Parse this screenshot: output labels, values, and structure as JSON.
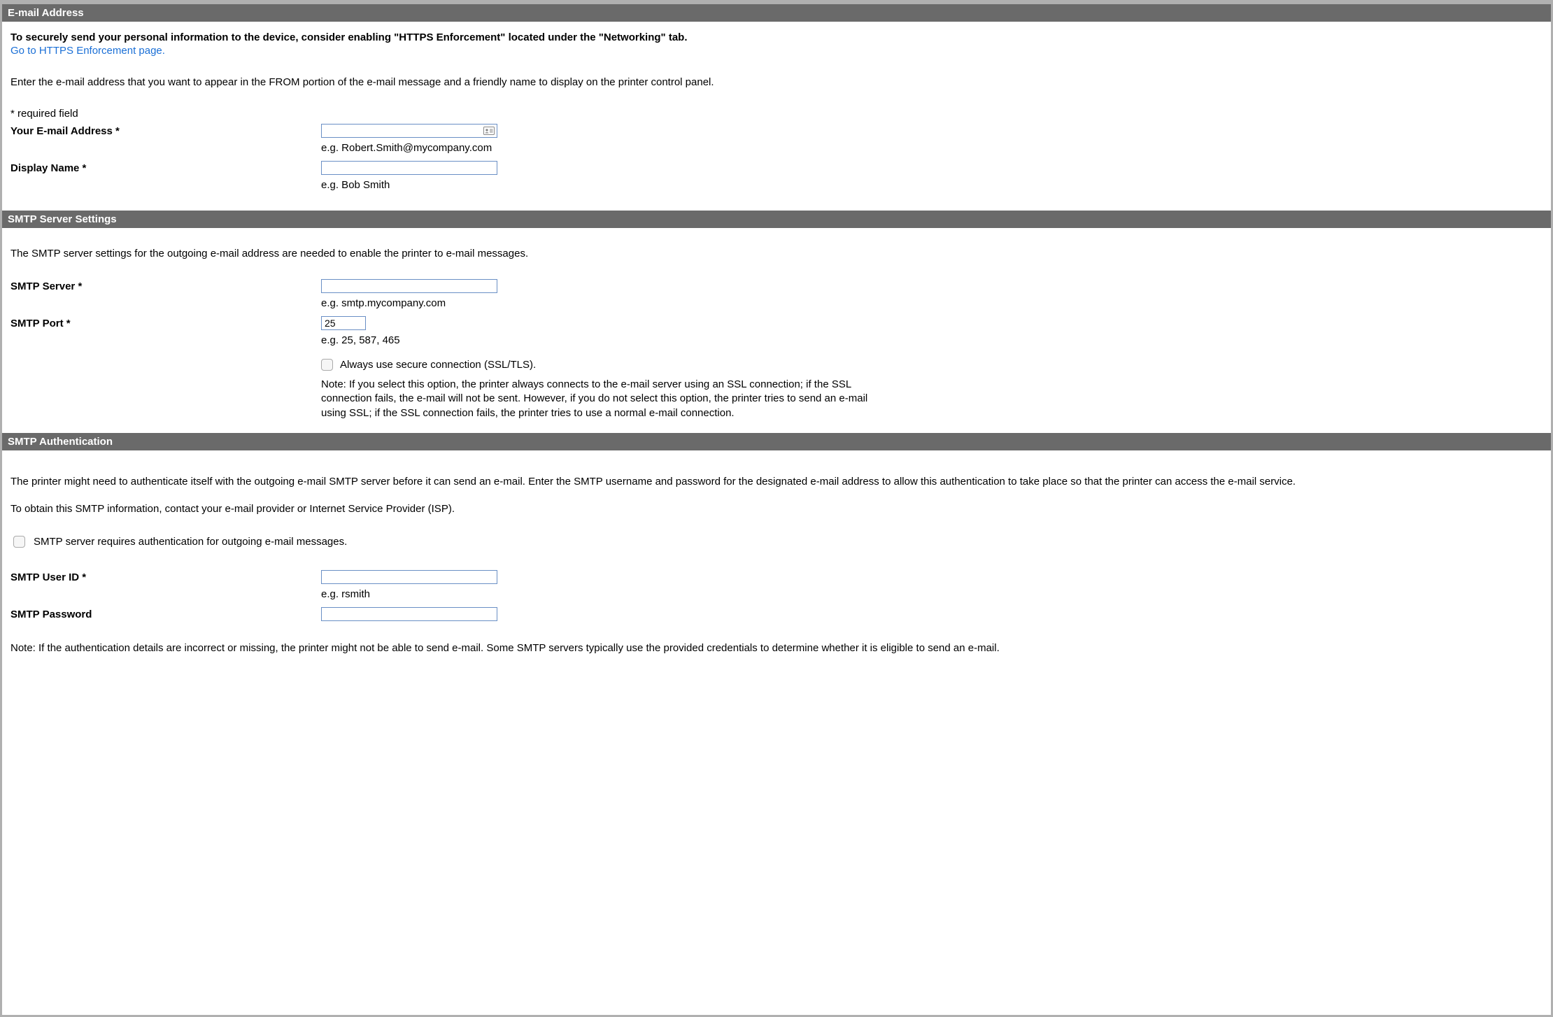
{
  "email_section": {
    "header": "E-mail Address",
    "security_notice": "To securely send your personal information to the device, consider enabling \"HTTPS Enforcement\" located under the \"Networking\" tab.",
    "https_link": "Go to HTTPS Enforcement page.",
    "description": "Enter the e-mail address that you want to appear in the FROM portion of the e-mail message and a friendly name to display on the printer control panel.",
    "required_note": "* required field",
    "email_label": "Your E-mail Address *",
    "email_value": "",
    "email_hint": "e.g. Robert.Smith@mycompany.com",
    "display_name_label": "Display Name *",
    "display_name_value": "",
    "display_name_hint": "e.g. Bob Smith"
  },
  "smtp_section": {
    "header": "SMTP Server Settings",
    "description": "The SMTP server settings for the outgoing e-mail address are needed to enable the printer to e-mail messages.",
    "server_label": "SMTP Server *",
    "server_value": "",
    "server_hint": "e.g. smtp.mycompany.com",
    "port_label": "SMTP Port *",
    "port_value": "25",
    "port_hint": "e.g. 25, 587, 465",
    "ssl_label": "Always use secure connection (SSL/TLS).",
    "ssl_note": "Note: If you select this option, the printer always connects to the e-mail server using an SSL connection; if the SSL connection fails, the e-mail will not be sent. However, if you do not select this option, the printer tries to send an e-mail using SSL; if the SSL connection fails, the printer tries to use a normal e-mail connection."
  },
  "auth_section": {
    "header": "SMTP Authentication",
    "description1": "The printer might need to authenticate itself with the outgoing e-mail SMTP server before it can send an e-mail. Enter the SMTP username and password for the designated e-mail address to allow this authentication to take place so that the printer can access the e-mail service.",
    "description2": "To obtain this SMTP information, contact your e-mail provider or Internet Service Provider (ISP).",
    "requires_auth_label": "SMTP server requires authentication for outgoing e-mail messages.",
    "user_label": "SMTP User ID *",
    "user_value": "",
    "user_hint": "e.g. rsmith",
    "password_label": "SMTP Password",
    "password_value": "",
    "note": "Note: If the authentication details are incorrect or missing, the printer might not be able to send e-mail. Some SMTP servers typically use the provided credentials to determine whether it is eligible to send an e-mail."
  }
}
